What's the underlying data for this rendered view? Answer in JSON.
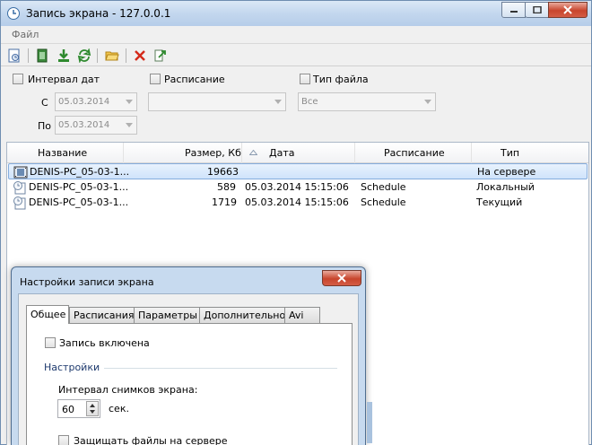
{
  "window": {
    "title": "Запись экрана - 127.0.0.1"
  },
  "menu": {
    "file": "Файл"
  },
  "toolbar": {
    "buttons": [
      "log-icon",
      "film-icon",
      "download-icon",
      "refresh-icon",
      "folder-icon",
      "delete-icon",
      "export-icon"
    ]
  },
  "filters": {
    "date_interval_label": "Интервал дат",
    "from_label": "С",
    "to_label": "По",
    "from_value": "05.03.2014",
    "to_value": "05.03.2014",
    "schedule_label": "Расписание",
    "schedule_value": "",
    "file_type_label": "Тип файла",
    "file_type_value": "Все"
  },
  "table": {
    "columns": [
      "Название",
      "Размер, Кб",
      "Дата",
      "Расписание",
      "Тип"
    ],
    "rows": [
      {
        "name": "DENIS-PC_05-03-1...",
        "size": "19663",
        "date": "",
        "schedule": "",
        "type": "На сервере",
        "icon": "film-icon"
      },
      {
        "name": "DENIS-PC_05-03-1...",
        "size": "589",
        "date": "05.03.2014 15:15:06",
        "schedule": "Schedule",
        "type": "Локальный",
        "icon": "clock-file-icon"
      },
      {
        "name": "DENIS-PC_05-03-1...",
        "size": "1719",
        "date": "05.03.2014 15:15:06",
        "schedule": "Schedule",
        "type": "Текущий",
        "icon": "clock-file-icon"
      }
    ]
  },
  "dialog": {
    "title": "Настройки записи экрана",
    "tabs": [
      "Общее",
      "Расписания",
      "Параметры",
      "Дополнительно",
      "Avi"
    ],
    "recording_enabled_label": "Запись включена",
    "settings_group_label": "Настройки",
    "interval_label": "Интервал снимков экрана:",
    "interval_value": "60",
    "interval_unit": "сек.",
    "protect_files_label": "Защищать файлы на сервере"
  }
}
